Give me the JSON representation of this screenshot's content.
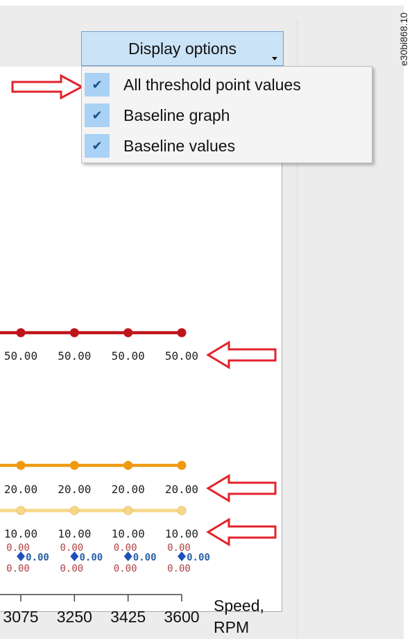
{
  "toolbar": {
    "display_options_label": "Display options"
  },
  "menu": {
    "items": [
      {
        "label": "All threshold point values",
        "checked": true
      },
      {
        "label": "Baseline graph",
        "checked": true
      },
      {
        "label": "Baseline values",
        "checked": true
      }
    ]
  },
  "side_note": "e30bi868.10",
  "colors": {
    "red_series": "#c0141b",
    "orange_series": "#ef9a12",
    "yellow_series": "#f7d88a",
    "baseline_marker": "#1f4fb8",
    "callout_arrow": "#e3222b"
  },
  "chart_data": {
    "type": "line",
    "x": [
      3075,
      3250,
      3425,
      3600
    ],
    "x_tick_labels": [
      "3075",
      "3250",
      "3425",
      "3600"
    ],
    "xlabel_line1": "Speed,",
    "xlabel_line2": "RPM",
    "series": [
      {
        "values": [
          50,
          50,
          50,
          50
        ],
        "labels": [
          "50.00",
          "50.00",
          "50.00",
          "50.00"
        ],
        "color": "#c0141b"
      },
      {
        "values": [
          20,
          20,
          20,
          20
        ],
        "labels": [
          "20.00",
          "20.00",
          "20.00",
          "20.00"
        ],
        "color": "#ef9a12"
      },
      {
        "values": [
          10,
          10,
          10,
          10
        ],
        "labels": [
          "10.00",
          "10.00",
          "10.00",
          "10.00"
        ],
        "color": "#f7d88a"
      }
    ],
    "baseline": {
      "values": [
        0,
        0,
        0,
        0
      ],
      "labels": [
        "0.00",
        "0.00",
        "0.00",
        "0.00"
      ],
      "zero_upper_labels": [
        "0.00",
        "0.00",
        "0.00",
        "0.00"
      ],
      "zero_lower_labels": [
        "0.00",
        "0.00",
        "0.00",
        "0.00"
      ]
    }
  }
}
